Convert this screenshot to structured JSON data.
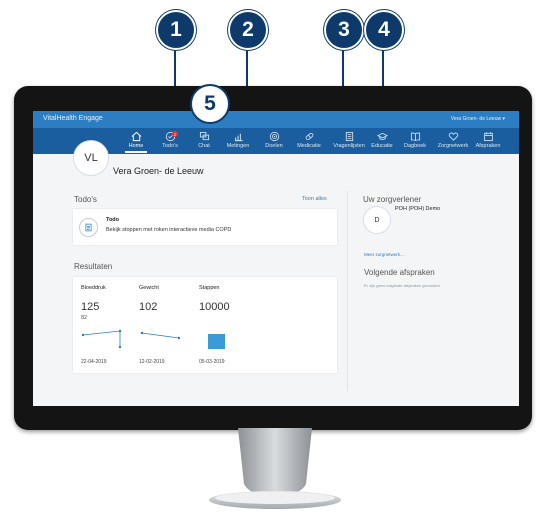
{
  "callouts": [
    {
      "label": "1"
    },
    {
      "label": "2"
    },
    {
      "label": "3"
    },
    {
      "label": "4"
    },
    {
      "label": "5"
    }
  ],
  "app": {
    "brand": "VitalHealth Engage",
    "user_menu": "Vera Groen- de Leeuw ▾"
  },
  "nav": {
    "items": [
      {
        "label": "Home",
        "icon": "home-icon"
      },
      {
        "label": "Todo's",
        "icon": "check-icon",
        "badge": "2"
      },
      {
        "label": "Chat",
        "icon": "chat-icon"
      },
      {
        "label": "Metingen",
        "icon": "chart-icon"
      },
      {
        "label": "Doelen",
        "icon": "target-icon"
      },
      {
        "label": "Medicatie",
        "icon": "pill-icon"
      },
      {
        "label": "Vragenlijsten",
        "icon": "clipboard-icon"
      },
      {
        "label": "Educatie",
        "icon": "graduation-icon"
      },
      {
        "label": "Dagboek",
        "icon": "book-icon"
      },
      {
        "label": "Zorgnetwerk",
        "icon": "heart-icon"
      },
      {
        "label": "Afspraken",
        "icon": "calendar-icon"
      }
    ]
  },
  "profile": {
    "initials": "VL",
    "name": "Vera Groen- de Leeuw"
  },
  "todos": {
    "title": "Todo's",
    "show_all": "Toon alles",
    "item": {
      "heading": "Todo",
      "text": "Bekijk stoppen met roken interactieve media COPD"
    }
  },
  "results": {
    "title": "Resultaten",
    "cards": [
      {
        "label": "Bloeddruk",
        "value": "125",
        "subvalue": "82",
        "date": "22-04-2019"
      },
      {
        "label": "Gewicht",
        "value": "102",
        "subvalue": "",
        "date": "12-02-2019"
      },
      {
        "label": "Stappen",
        "value": "10000",
        "subvalue": "",
        "date": "05-03-2019"
      }
    ]
  },
  "care": {
    "title": "Uw zorgverlener",
    "initial": "D",
    "provider": "POH (POH) Demo",
    "more": "Meer zorgnetwerk..."
  },
  "appointments": {
    "title": "Volgende afspraken",
    "empty": "Er zijn geen volgende afspraken gevonden"
  }
}
